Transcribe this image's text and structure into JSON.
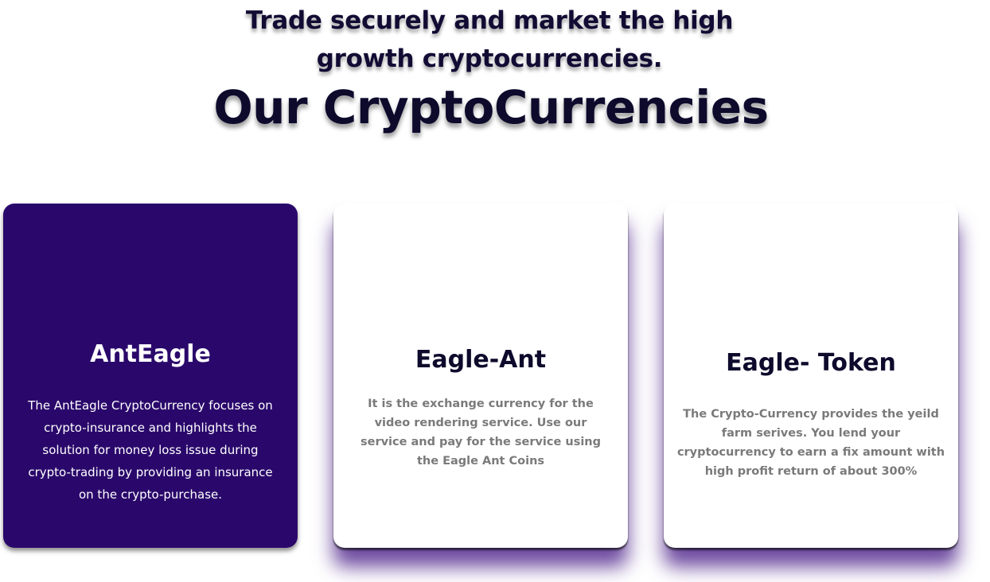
{
  "header": {
    "tagline": "Trade securely and market the high growth cryptocurrencies.",
    "title": "Our CryptoCurrencies"
  },
  "cards": [
    {
      "title": "AntEagle",
      "description": "The AntEagle CryptoCurrency focuses on crypto-insurance and highlights the solution for money loss issue during crypto-trading by providing an insurance on the crypto-purchase."
    },
    {
      "title": "Eagle-Ant",
      "description": "It is the exchange currency for the video rendering service. Use our service and pay for the service using the Eagle Ant Coins"
    },
    {
      "title": "Eagle- Token",
      "description": "The Crypto-Currency provides the yeild farm serives. You lend your cryptocurrency to earn a fix amount with high profit return of about 300%"
    }
  ],
  "colors": {
    "accent": "#2a086b",
    "heading": "#0d0a2c",
    "muted_text": "#7a7a7a",
    "background": "#ffffff"
  }
}
